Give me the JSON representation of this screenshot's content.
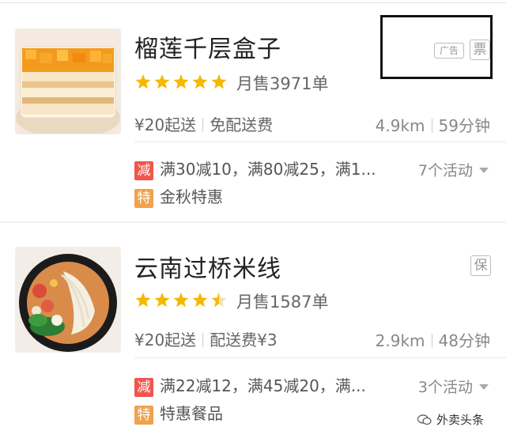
{
  "shops": [
    {
      "name": "榴莲千层盒子",
      "rating": 5,
      "monthly_sales": "月售3971单",
      "min_order": "¥20起送",
      "delivery_fee": "免配送费",
      "distance": "4.9km",
      "eta": "59分钟",
      "promos": [
        {
          "tag": "减",
          "text": "满30减10，满80减25，满1..."
        },
        {
          "tag": "特",
          "text": "金秋特惠"
        }
      ],
      "activity_count": "7个活动",
      "badges": [
        "广告",
        "票"
      ]
    },
    {
      "name": "云南过桥米线",
      "rating": 4.5,
      "monthly_sales": "月售1587单",
      "min_order": "¥20起送",
      "delivery_fee": "配送费¥3",
      "distance": "2.9km",
      "eta": "48分钟",
      "promos": [
        {
          "tag": "减",
          "text": "满22减12，满45减20，满..."
        },
        {
          "tag": "特",
          "text": "特惠餐品"
        }
      ],
      "activity_count": "3个活动",
      "badges": [
        "保"
      ]
    }
  ],
  "watermark": "外卖头条",
  "colors": {
    "star": "#f5b800",
    "reduce_tag": "#f0564d",
    "special_tag": "#f0a24d"
  }
}
